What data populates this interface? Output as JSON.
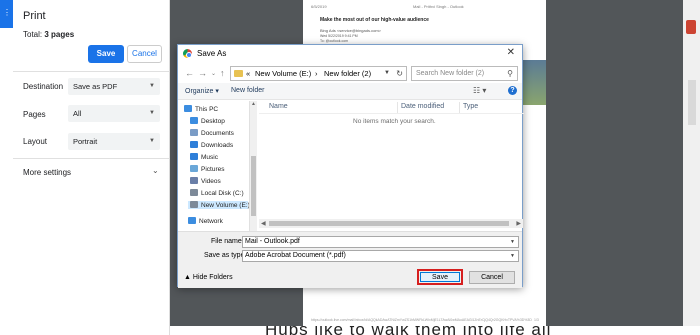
{
  "print_panel": {
    "title": "Print",
    "total_label": "Total:",
    "total_value": "3 pages",
    "save_button": "Save",
    "cancel_button": "Cancel",
    "settings": [
      {
        "label": "Destination",
        "value": "Save as PDF"
      },
      {
        "label": "Pages",
        "value": "All"
      },
      {
        "label": "Layout",
        "value": "Portrait"
      }
    ],
    "more_settings": "More settings"
  },
  "preview": {
    "header_date": "6/5/2019",
    "header_title": "Mail - Prithvi Singh - Outlook",
    "heading": "Make the most out of our high-value audience",
    "sender": "Bing Ads <service@bingads.com>",
    "sent": "Wed 5/22/2019 9:41 PM",
    "to": "To: @outlook.com",
    "footer_url": "https://outlook.live.com/mail/inbox/id/AQQkADAwATNiZmYwZS1hMWFkLWIxMjE1LTAwAi0wMAoAEAGl1ZnErCjQ4Qr2GQKHvTPVA%3D%3D",
    "footer_page": "1/3",
    "bottom_text": "Hubs like to walk them into life all"
  },
  "dialog": {
    "title": "Save As",
    "close": "✕",
    "breadcrumb": [
      "«",
      "New Volume (E:)",
      "›",
      "New folder (2)"
    ],
    "search_placeholder": "Search New folder (2)",
    "organize": "Organize ▾",
    "new_folder": "New folder",
    "nav_items": [
      {
        "label": "This PC",
        "icon": "computer-icon",
        "color": "#3c8de0"
      },
      {
        "label": "Desktop",
        "icon": "desktop-icon",
        "color": "#3c8de0"
      },
      {
        "label": "Documents",
        "icon": "documents-icon",
        "color": "#7a9cc6"
      },
      {
        "label": "Downloads",
        "icon": "downloads-icon",
        "color": "#2e7fd9"
      },
      {
        "label": "Music",
        "icon": "music-icon",
        "color": "#2e7fd9"
      },
      {
        "label": "Pictures",
        "icon": "pictures-icon",
        "color": "#6aa7d8"
      },
      {
        "label": "Videos",
        "icon": "videos-icon",
        "color": "#6a7fa8"
      },
      {
        "label": "Local Disk (C:)",
        "icon": "drive-icon",
        "color": "#7d8a99"
      },
      {
        "label": "New Volume (E:)",
        "icon": "drive-icon",
        "color": "#7d8a99"
      }
    ],
    "network": "Network",
    "columns": [
      "Name",
      "Date modified",
      "Type"
    ],
    "empty_message": "No items match your search.",
    "file_name_label": "File name:",
    "file_name_value": "Mail - Outlook.pdf",
    "save_as_type_label": "Save as type:",
    "save_as_type_value": "Adobe Acrobat Document (*.pdf)",
    "hide_folders": "Hide Folders",
    "save_button": "Save",
    "cancel_button": "Cancel"
  },
  "colors": {
    "accent": "#1a73e8",
    "highlight_border": "#d61f1f",
    "preview_bg": "#525659"
  }
}
